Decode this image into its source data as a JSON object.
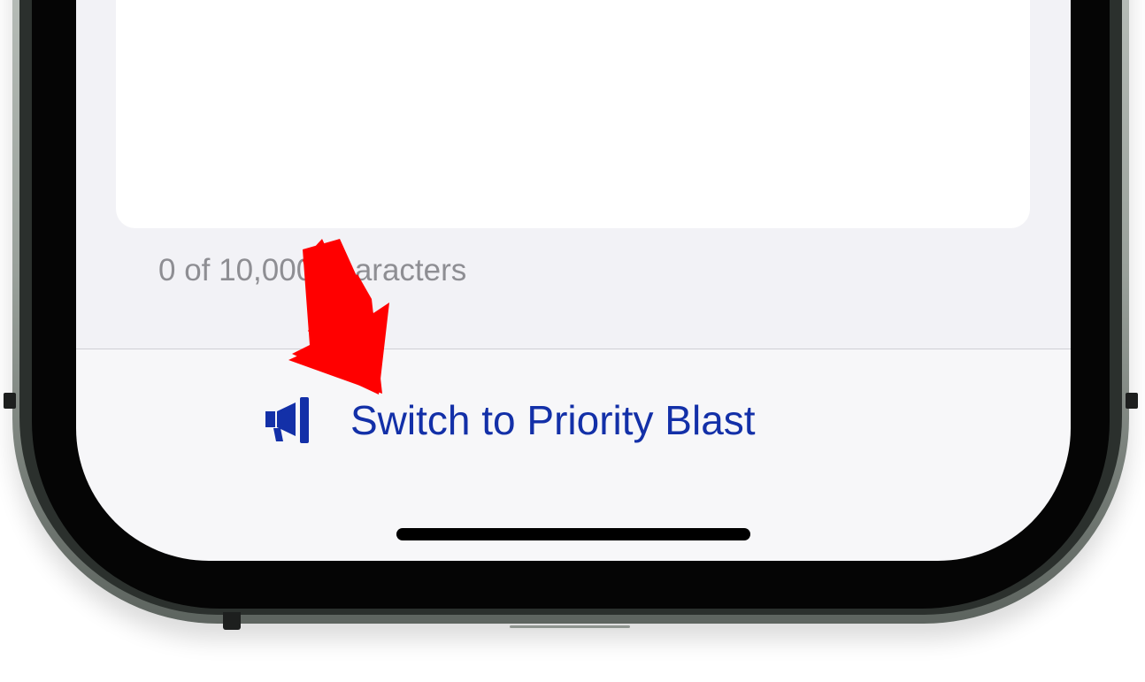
{
  "composer": {
    "char_count": "0 of 10,000 characters"
  },
  "bottom_bar": {
    "switch_label": "Switch to Priority Blast",
    "icon": "megaphone-icon"
  },
  "colors": {
    "accent": "#1330a8",
    "arrow": "#ff0000",
    "muted_text": "#8e8e93",
    "screen_bg": "#f7f7f9"
  }
}
